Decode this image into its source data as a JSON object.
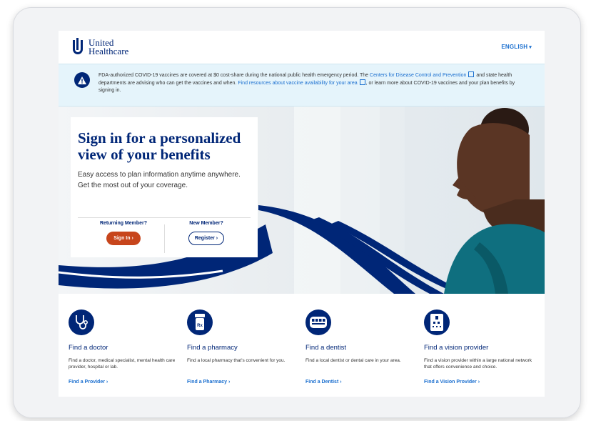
{
  "brand": {
    "line1": "United",
    "line2": "Healthcare"
  },
  "header": {
    "language": "ENGLISH"
  },
  "alert": {
    "text_part1": "FDA-authorized COVID-19 vaccines are covered at $0 cost-share during the national public health emergency period. The ",
    "link_cdc": "Centers for Disease Control and Prevention",
    "text_part2": " and state health departments are advising who can get the vaccines and when. ",
    "link_resources": "Find resources about vaccine availability for your area",
    "text_part3": ", or learn more about COVID-19 vaccines and your plan benefits by signing in."
  },
  "hero": {
    "title": "Sign in for a personalized view of your benefits",
    "subtitle_line1": "Easy access to plan information anytime anywhere.",
    "subtitle_line2": "Get the most out of your coverage.",
    "returning_label": "Returning Member?",
    "signin_button": "Sign In ›",
    "new_label": "New Member?",
    "register_button": "Register ›"
  },
  "services": [
    {
      "title": "Find a doctor",
      "description": "Find a doctor, medical specialist, mental health care provider, hospital or lab.",
      "link": "Find a Provider ›",
      "icon": "stethoscope-icon"
    },
    {
      "title": "Find a pharmacy",
      "description": "Find a local pharmacy that's convenient for you.",
      "link": "Find a Pharmacy ›",
      "icon": "pill-bottle-icon"
    },
    {
      "title": "Find a dentist",
      "description": "Find a local dentist or dental care in your area.",
      "link": "Find a Dentist ›",
      "icon": "teeth-icon"
    },
    {
      "title": "Find a vision provider",
      "description": "Find a vision provider within a large national network that offers convenience and choice.",
      "link": "Find a Vision Provider ›",
      "icon": "eye-chart-icon"
    }
  ],
  "colors": {
    "navy": "#002677",
    "link_blue": "#196ecf",
    "signin_orange": "#c7451c",
    "alert_bg": "#e5f4fb"
  }
}
